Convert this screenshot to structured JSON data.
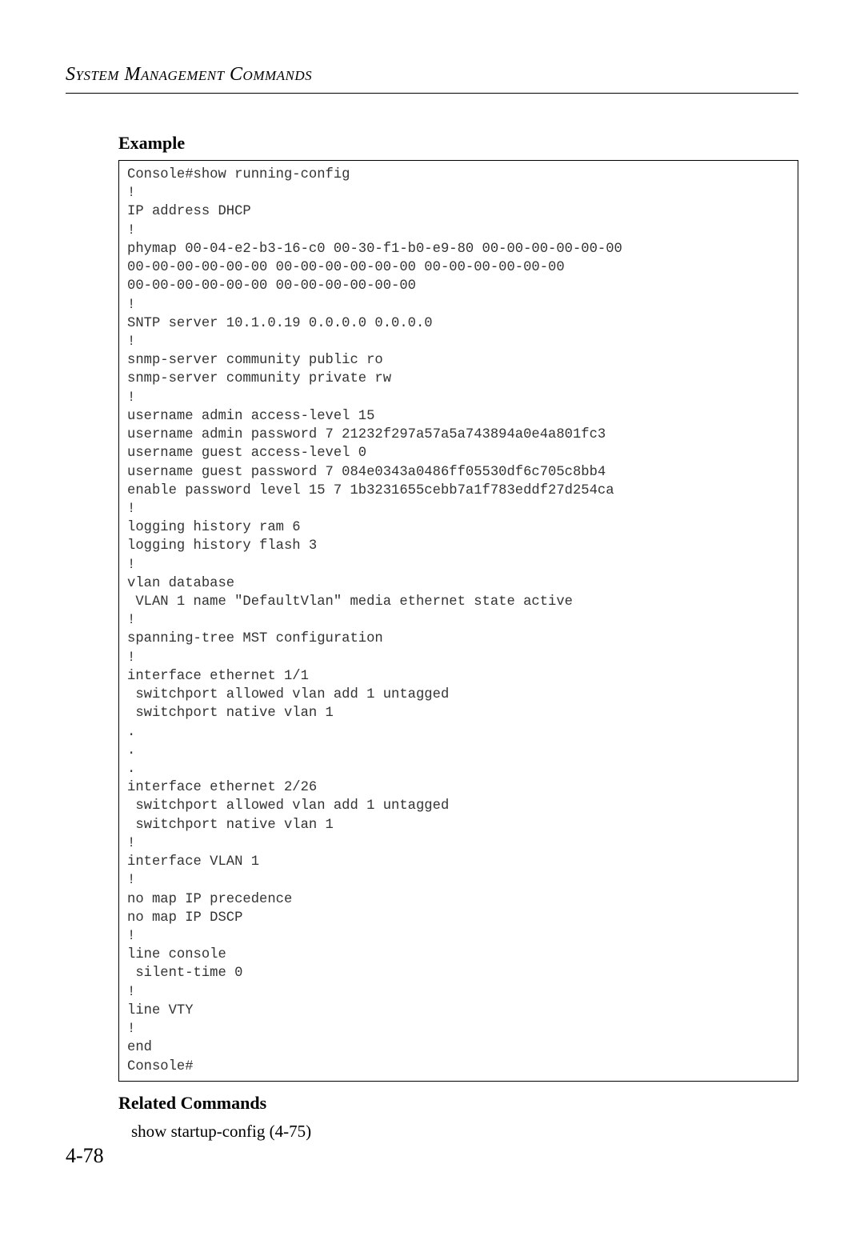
{
  "header": {
    "title": "System Management Commands"
  },
  "sections": {
    "example_heading": "Example",
    "related_heading": "Related Commands",
    "related_body": "show startup-config (4-75)"
  },
  "code": {
    "lines": [
      "Console#show running-config",
      "!",
      "IP address DHCP",
      "!",
      "phymap 00-04-e2-b3-16-c0 00-30-f1-b0-e9-80 00-00-00-00-00-00 ",
      "00-00-00-00-00-00 00-00-00-00-00-00 00-00-00-00-00-00 ",
      "00-00-00-00-00-00 00-00-00-00-00-00",
      "!",
      "SNTP server 10.1.0.19 0.0.0.0 0.0.0.0",
      "!",
      "snmp-server community public ro",
      "snmp-server community private rw",
      "!",
      "username admin access-level 15",
      "username admin password 7 21232f297a57a5a743894a0e4a801fc3",
      "username guest access-level 0",
      "username guest password 7 084e0343a0486ff05530df6c705c8bb4",
      "enable password level 15 7 1b3231655cebb7a1f783eddf27d254ca",
      "!",
      "logging history ram 6",
      "logging history flash 3",
      "!",
      "vlan database",
      " VLAN 1 name \"DefaultVlan\" media ethernet state active",
      "!",
      "spanning-tree MST configuration",
      "!",
      "interface ethernet 1/1",
      " switchport allowed vlan add 1 untagged",
      " switchport native vlan 1",
      ".",
      ".",
      ".",
      "interface ethernet 2/26",
      " switchport allowed vlan add 1 untagged",
      " switchport native vlan 1",
      "!",
      "interface VLAN 1",
      "!",
      "no map IP precedence",
      "no map IP DSCP",
      "!",
      "line console",
      " silent-time 0",
      "!",
      "line VTY",
      "!",
      "end",
      "Console#"
    ]
  },
  "footer": {
    "page_number": "4-78"
  }
}
